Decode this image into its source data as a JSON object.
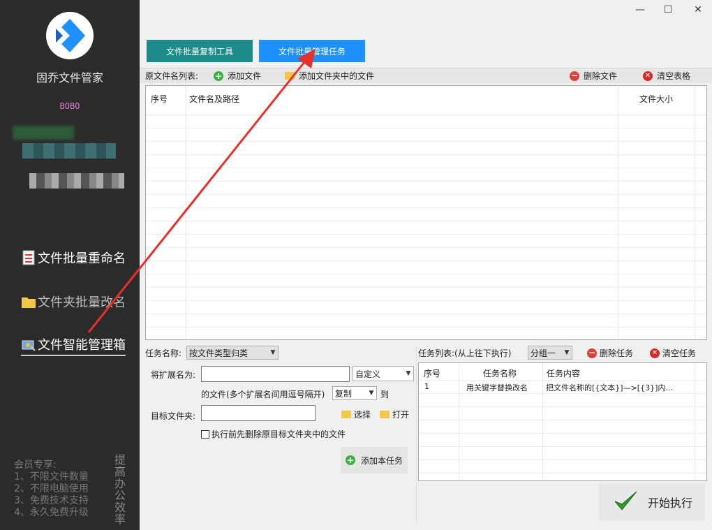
{
  "window_controls": {
    "minimize": "—",
    "maximize": "☐",
    "close": "✕"
  },
  "sidebar": {
    "app_name": "固乔文件管家",
    "user": "BOBO",
    "nav": [
      {
        "label": "文件批量重命名",
        "icon": "document-icon"
      },
      {
        "label": "文件夹批量改名",
        "icon": "folder-icon"
      },
      {
        "label": "文件智能管理箱",
        "icon": "toolbox-icon",
        "active": true
      }
    ],
    "member_title": "会员专享:",
    "member_items": [
      "1、不限文件数量",
      "2、不限电脑使用",
      "3、免费技术支持",
      "4、永久免费升级"
    ],
    "slogan": "提高办公效率"
  },
  "tabs": [
    {
      "label": "文件批量复制工具",
      "color": "#1e8b8b"
    },
    {
      "label": "文件批量管理任务",
      "color": "#1e90ff",
      "active": true
    }
  ],
  "file_toolbar": {
    "title": "原文件名列表:",
    "add_file": "添加文件",
    "add_folder_files": "添加文件夹中的文件",
    "delete_file": "删除文件",
    "clear_table": "清空表格"
  },
  "file_table": {
    "columns": [
      "序号",
      "文件名及路径",
      "文件大小"
    ],
    "rows": []
  },
  "task_form": {
    "task_name_label": "任务名称:",
    "task_name_value": "按文件类型归类",
    "ext_label": "将扩展名为:",
    "ext_value": "",
    "ext_mode": "自定义",
    "ext_hint": "的文件(多个扩展名间用逗号隔开)",
    "action": "复制",
    "to_label": "到",
    "target_label": "目标文件夹:",
    "target_value": "",
    "choose": "选择",
    "open": "打开",
    "checkbox": "执行前先删除原目标文件夹中的文件",
    "checkbox_checked": false,
    "add_task": "添加本任务"
  },
  "task_list": {
    "title": "任务列表:(从上往下执行)",
    "group": "分组一",
    "delete_task": "删除任务",
    "clear_tasks": "清空任务",
    "columns": [
      "序号",
      "任务名称",
      "任务内容"
    ],
    "rows": [
      {
        "no": "1",
        "name": "用关键字替换改名",
        "content": "把文件名称的[{文本}]—>[{3}]内..."
      }
    ]
  },
  "start_button": "开始执行"
}
